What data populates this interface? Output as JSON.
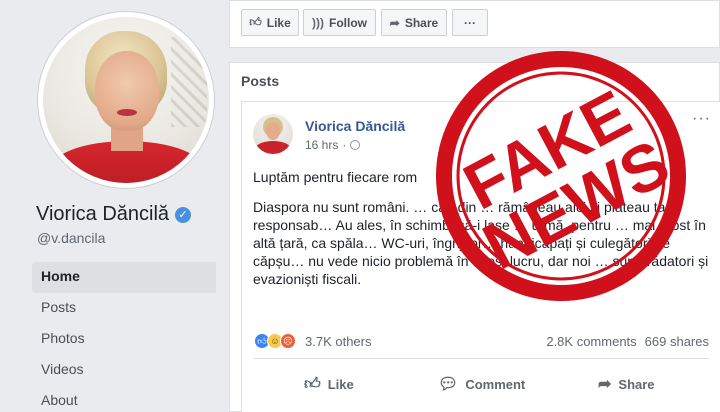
{
  "profile": {
    "name": "Viorica Dăncilă",
    "verified_glyph": "✓",
    "handle": "@v.dancila"
  },
  "nav": {
    "items": [
      {
        "label": "Home",
        "active": true
      },
      {
        "label": "Posts"
      },
      {
        "label": "Photos"
      },
      {
        "label": "Videos"
      },
      {
        "label": "About"
      }
    ]
  },
  "actions": {
    "like_label": "Like",
    "follow_label": "Follow",
    "share_label": "Share",
    "more_label": "···"
  },
  "posts": {
    "section_title": "Posts",
    "post": {
      "author": "Viorica Dăncilă",
      "time": "16 hrs",
      "more_label": "···",
      "paragraph_1": "Luptăm pentru fiecare rom",
      "paragraph_2": "Diaspora nu sunt români. … cau din … rămâneau aici și plăteau ta… responsab… Au ales, în schimb, să-i lase … urmă, pentru … mai prost în altă țară, ca spăla… WC-uri, îngrijitor… handicapați și culegători de căpșu… nu vede nicio problemă în acest lucru, dar noi … sunt trădatori și evazioniști fiscali.",
      "reaction_count": "3.7K others",
      "comments": "2.8K comments",
      "shares": "669 shares",
      "like_label": "Like",
      "comment_label": "Comment",
      "share_label": "Share"
    }
  },
  "stamp": {
    "line1": "FAKE",
    "line2": "NEWS",
    "color": "#d0101a"
  },
  "colors": {
    "link": "#365899",
    "verified": "#4a90e2",
    "background": "#e9ebee"
  },
  "icons": [
    "thumbs-up-icon",
    "rss-icon",
    "share-arrow-icon",
    "ellipsis-icon",
    "globe-icon",
    "comment-bubble-icon",
    "verified-check-icon"
  ]
}
